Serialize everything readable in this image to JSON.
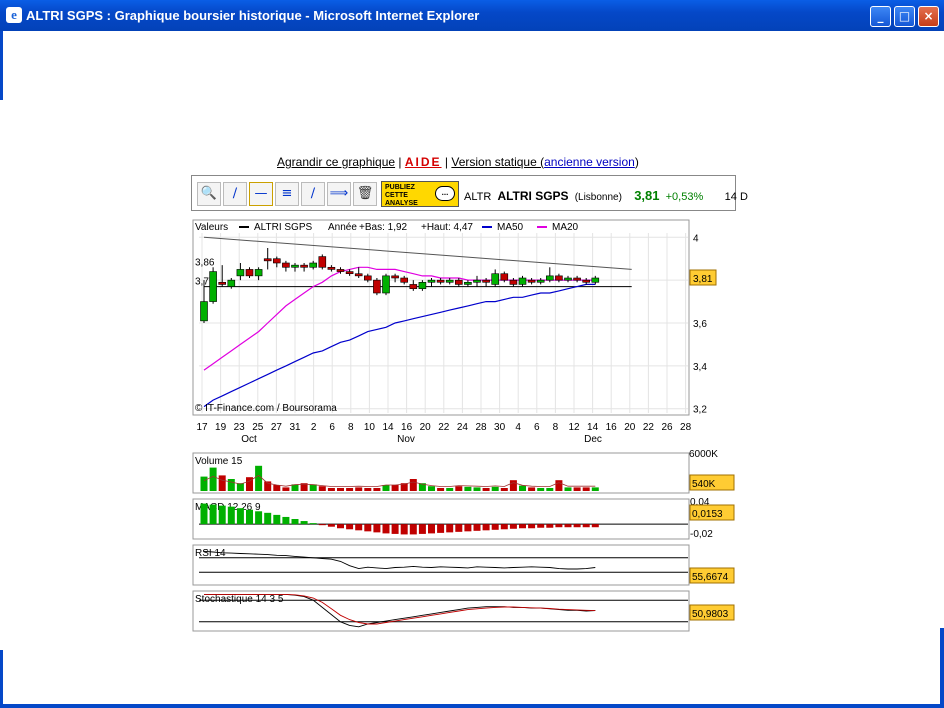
{
  "window": {
    "title": "ALTRI SGPS : Graphique boursier historique - Microsoft Internet Explorer",
    "minimize": "_",
    "maximize": "□",
    "close": "×"
  },
  "links": {
    "enlarge": "Agrandir ce graphique",
    "sep1": "|",
    "help": "AIDE",
    "sep2": "|",
    "static": "Version statique (",
    "old": "ancienne version",
    "close_paren": ")"
  },
  "toolbar": {
    "icons": [
      "zoom-icon",
      "trendline-icon",
      "horizontal-line-icon",
      "fibonacci-icon",
      "parallel-line-icon",
      "slanted-line-icon",
      "trash-icon"
    ],
    "publish": [
      "PUBLIEZ",
      "CETTE",
      "ANALYSE"
    ],
    "bubble": "..."
  },
  "quote": {
    "code": "ALTR",
    "name": "ALTRI SGPS",
    "market": "(Lisbonne)",
    "price": "3,81",
    "change": "+0,53%",
    "period": "14 D",
    "price_color": "#008000"
  },
  "chart_data": [
    {
      "type": "candlestick",
      "legend": {
        "valeurs": "Valeurs",
        "series": "ALTRI SGPS",
        "year": "Année",
        "low": "+Bas: 1,92",
        "high": "+Haut: 4,47",
        "ma50": "MA50",
        "ma20": "MA20"
      },
      "colors": {
        "up": "#00b000",
        "down": "#c00000",
        "ma50": "#0000cc",
        "ma20": "#e000e0"
      },
      "y_ticks": [
        "4",
        "3,8",
        "3,6",
        "3,4",
        "3,2"
      ],
      "ylim": [
        3.18,
        4.02
      ],
      "left_labels": [
        "3,86",
        "3,77"
      ],
      "last_value": "3,81",
      "x_days": [
        "17",
        "19",
        "23",
        "25",
        "27",
        "31",
        "2",
        "6",
        "8",
        "10",
        "14",
        "16",
        "20",
        "22",
        "24",
        "28",
        "30",
        "4",
        "6",
        "8",
        "12",
        "14",
        "16",
        "20",
        "22",
        "26",
        "28"
      ],
      "x_months": [
        "Oct",
        "Nov",
        "Dec"
      ],
      "copyright": "© IT-Finance.com / Boursorama",
      "candles": [
        [
          3.61,
          3.7,
          3.6,
          3.8
        ],
        [
          3.7,
          3.84,
          3.69,
          3.86
        ],
        [
          3.79,
          3.78,
          3.77,
          3.87
        ],
        [
          3.77,
          3.8,
          3.76,
          3.81
        ],
        [
          3.82,
          3.85,
          3.8,
          3.88
        ],
        [
          3.85,
          3.82,
          3.81,
          3.86
        ],
        [
          3.82,
          3.85,
          3.8,
          3.86
        ],
        [
          3.9,
          3.89,
          3.85,
          3.95
        ],
        [
          3.9,
          3.88,
          3.86,
          3.91
        ],
        [
          3.88,
          3.86,
          3.84,
          3.89
        ],
        [
          3.86,
          3.87,
          3.84,
          3.88
        ],
        [
          3.87,
          3.86,
          3.84,
          3.88
        ],
        [
          3.86,
          3.88,
          3.85,
          3.89
        ],
        [
          3.91,
          3.86,
          3.85,
          3.92
        ],
        [
          3.86,
          3.85,
          3.84,
          3.87
        ],
        [
          3.85,
          3.84,
          3.83,
          3.86
        ],
        [
          3.84,
          3.83,
          3.82,
          3.85
        ],
        [
          3.83,
          3.82,
          3.81,
          3.86
        ],
        [
          3.82,
          3.8,
          3.79,
          3.83
        ],
        [
          3.8,
          3.74,
          3.73,
          3.81
        ],
        [
          3.74,
          3.82,
          3.73,
          3.83
        ],
        [
          3.82,
          3.81,
          3.79,
          3.83
        ],
        [
          3.81,
          3.79,
          3.78,
          3.82
        ],
        [
          3.78,
          3.76,
          3.75,
          3.8
        ],
        [
          3.76,
          3.79,
          3.75,
          3.8
        ],
        [
          3.79,
          3.8,
          3.77,
          3.81
        ],
        [
          3.8,
          3.79,
          3.78,
          3.81
        ],
        [
          3.79,
          3.8,
          3.78,
          3.81
        ],
        [
          3.8,
          3.78,
          3.77,
          3.81
        ],
        [
          3.78,
          3.79,
          3.77,
          3.8
        ],
        [
          3.79,
          3.8,
          3.77,
          3.82
        ],
        [
          3.8,
          3.79,
          3.77,
          3.81
        ],
        [
          3.78,
          3.83,
          3.77,
          3.85
        ],
        [
          3.83,
          3.8,
          3.79,
          3.84
        ],
        [
          3.8,
          3.78,
          3.77,
          3.81
        ],
        [
          3.78,
          3.81,
          3.77,
          3.82
        ],
        [
          3.8,
          3.79,
          3.78,
          3.81
        ],
        [
          3.79,
          3.8,
          3.78,
          3.81
        ],
        [
          3.8,
          3.82,
          3.79,
          3.86
        ],
        [
          3.82,
          3.8,
          3.79,
          3.83
        ],
        [
          3.8,
          3.81,
          3.79,
          3.82
        ],
        [
          3.81,
          3.8,
          3.79,
          3.82
        ],
        [
          3.8,
          3.79,
          3.78,
          3.81
        ],
        [
          3.79,
          3.81,
          3.78,
          3.82
        ]
      ],
      "ma50": [
        3.21,
        3.24,
        3.26,
        3.28,
        3.3,
        3.32,
        3.34,
        3.36,
        3.38,
        3.4,
        3.42,
        3.44,
        3.46,
        3.47,
        3.49,
        3.51,
        3.52,
        3.54,
        3.56,
        3.57,
        3.58,
        3.6,
        3.61,
        3.62,
        3.63,
        3.64,
        3.65,
        3.66,
        3.67,
        3.68,
        3.69,
        3.7,
        3.7,
        3.71,
        3.72,
        3.72,
        3.73,
        3.74,
        3.74,
        3.75,
        3.76,
        3.77,
        3.78,
        3.78
      ],
      "ma20": [
        3.38,
        3.41,
        3.44,
        3.47,
        3.5,
        3.53,
        3.56,
        3.6,
        3.64,
        3.68,
        3.71,
        3.74,
        3.77,
        3.79,
        3.82,
        3.84,
        3.85,
        3.86,
        3.86,
        3.85,
        3.85,
        3.85,
        3.84,
        3.83,
        3.82,
        3.82,
        3.81,
        3.81,
        3.81,
        3.8,
        3.8,
        3.8,
        3.8,
        3.8,
        3.8,
        3.8,
        3.8,
        3.8,
        3.8,
        3.8,
        3.8,
        3.8,
        3.8,
        3.8
      ],
      "resistance": [
        [
          0,
          4.0
        ],
        [
          47,
          3.85
        ]
      ],
      "support": [
        [
          0,
          3.77
        ],
        [
          47,
          3.77
        ]
      ]
    },
    {
      "type": "bar",
      "title": "Volume 15",
      "ticks": [
        "6000K"
      ],
      "last_value": "540K",
      "ylim": [
        0,
        6000
      ],
      "values": [
        2400,
        3900,
        2600,
        2000,
        1300,
        2300,
        4200,
        1600,
        1000,
        600,
        1100,
        1300,
        1100,
        800,
        500,
        500,
        500,
        600,
        500,
        500,
        1000,
        1000,
        1300,
        2000,
        1300,
        800,
        500,
        500,
        800,
        700,
        600,
        500,
        700,
        500,
        1800,
        900,
        600,
        500,
        500,
        1800,
        600,
        600,
        600,
        600
      ]
    },
    {
      "type": "bar",
      "title": "MACD 12 26 9",
      "ticks": [
        "0,04",
        "-0,02"
      ],
      "last_value": "0,0153",
      "ylim": [
        -0.025,
        0.045
      ],
      "values": [
        0.04,
        0.038,
        0.036,
        0.034,
        0.031,
        0.028,
        0.025,
        0.022,
        0.018,
        0.014,
        0.01,
        0.006,
        0.002,
        -0.002,
        -0.005,
        -0.008,
        -0.01,
        -0.012,
        -0.014,
        -0.016,
        -0.018,
        -0.019,
        -0.02,
        -0.02,
        -0.019,
        -0.018,
        -0.017,
        -0.016,
        -0.015,
        -0.014,
        -0.013,
        -0.012,
        -0.011,
        -0.01,
        -0.009,
        -0.008,
        -0.008,
        -0.007,
        -0.007,
        -0.006,
        -0.006,
        -0.006,
        -0.006,
        -0.006
      ]
    },
    {
      "type": "line",
      "title": "RSI 14",
      "last_value": "55,6674",
      "ylim": [
        0,
        100
      ],
      "values": [
        88,
        86,
        84,
        83,
        82,
        81,
        80,
        79,
        77,
        76,
        74,
        72,
        70,
        68,
        66,
        60,
        48,
        40,
        44,
        42,
        40,
        43,
        44,
        46,
        44,
        43,
        45,
        44,
        43,
        42,
        45,
        44,
        43,
        42,
        43,
        44,
        45,
        44,
        43,
        40,
        39,
        39,
        40,
        43
      ]
    },
    {
      "type": "line",
      "title": "Stochastique 14 3 5",
      "last_value": "50,9803",
      "ylim": [
        0,
        100
      ],
      "k": [
        96,
        96,
        96,
        96,
        96,
        96,
        96,
        96,
        96,
        96,
        94,
        90,
        80,
        60,
        40,
        20,
        10,
        6,
        14,
        18,
        22,
        26,
        30,
        34,
        38,
        42,
        46,
        50,
        54,
        58,
        60,
        62,
        62,
        62,
        60,
        60,
        58,
        58,
        56,
        54,
        52,
        52,
        50,
        51
      ],
      "d": [
        96,
        96,
        96,
        96,
        96,
        96,
        96,
        96,
        96,
        96,
        95,
        92,
        86,
        74,
        56,
        38,
        26,
        18,
        14,
        14,
        18,
        22,
        26,
        30,
        34,
        38,
        42,
        46,
        50,
        54,
        56,
        58,
        60,
        61,
        61,
        60,
        59,
        58,
        57,
        55,
        54,
        53,
        52,
        51
      ]
    }
  ]
}
